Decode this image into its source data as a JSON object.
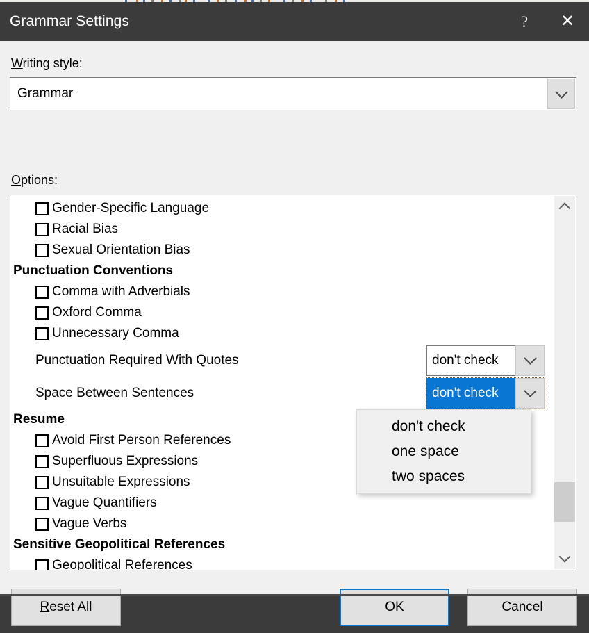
{
  "window": {
    "title": "Grammar Settings",
    "help_icon": "?",
    "close_icon": "✕"
  },
  "writing_style": {
    "label_prefix": "W",
    "label_rest": "riting style:",
    "value": "Grammar",
    "arrow_icon": "chevron-down-icon"
  },
  "options": {
    "label_prefix": "O",
    "label_rest": "ptions:",
    "items": [
      {
        "type": "checkbox",
        "label": "Gender-Specific Language",
        "checked": false
      },
      {
        "type": "checkbox",
        "label": "Racial Bias",
        "checked": false
      },
      {
        "type": "checkbox",
        "label": "Sexual Orientation Bias",
        "checked": false
      },
      {
        "type": "group",
        "label": "Punctuation Conventions"
      },
      {
        "type": "checkbox",
        "label": "Comma with Adverbials",
        "checked": false
      },
      {
        "type": "checkbox",
        "label": "Oxford Comma",
        "checked": false
      },
      {
        "type": "checkbox",
        "label": "Unnecessary Comma",
        "checked": false
      },
      {
        "type": "combo",
        "label": "Punctuation Required With Quotes",
        "value": "don't check",
        "focused": false
      },
      {
        "type": "combo",
        "label": "Space Between Sentences",
        "value": "don't check",
        "focused": true
      },
      {
        "type": "group",
        "label": "Resume"
      },
      {
        "type": "checkbox",
        "label": "Avoid First Person References",
        "checked": false
      },
      {
        "type": "checkbox",
        "label": "Superfluous Expressions",
        "checked": false
      },
      {
        "type": "checkbox",
        "label": "Unsuitable Expressions",
        "checked": false
      },
      {
        "type": "checkbox",
        "label": "Vague Quantifiers",
        "checked": false
      },
      {
        "type": "checkbox",
        "label": "Vague Verbs",
        "checked": false
      },
      {
        "type": "group",
        "label": "Sensitive Geopolitical References"
      },
      {
        "type": "checkbox",
        "label": "Geopolitical References",
        "checked": false
      }
    ]
  },
  "scrollbar": {
    "up_icon": "chevron-up-icon",
    "down_icon": "chevron-down-icon",
    "thumb_top_pct": 80,
    "thumb_height_pct": 12
  },
  "dropdown_popup": {
    "open": true,
    "owner": "Space Between Sentences",
    "options": [
      "don't check",
      "one space",
      "two spaces"
    ],
    "selected": "don't check"
  },
  "footer": {
    "reset_prefix": "R",
    "reset_rest": "eset All",
    "ok_label": "OK",
    "cancel_label": "Cancel"
  },
  "colors": {
    "titlebar": "#3b3b3b",
    "dialog_bg": "#f0f0f0",
    "accent_blue": "#0a76d4",
    "selection_blue": "#0a76d4",
    "scroll_thumb": "#cdcdcd"
  }
}
